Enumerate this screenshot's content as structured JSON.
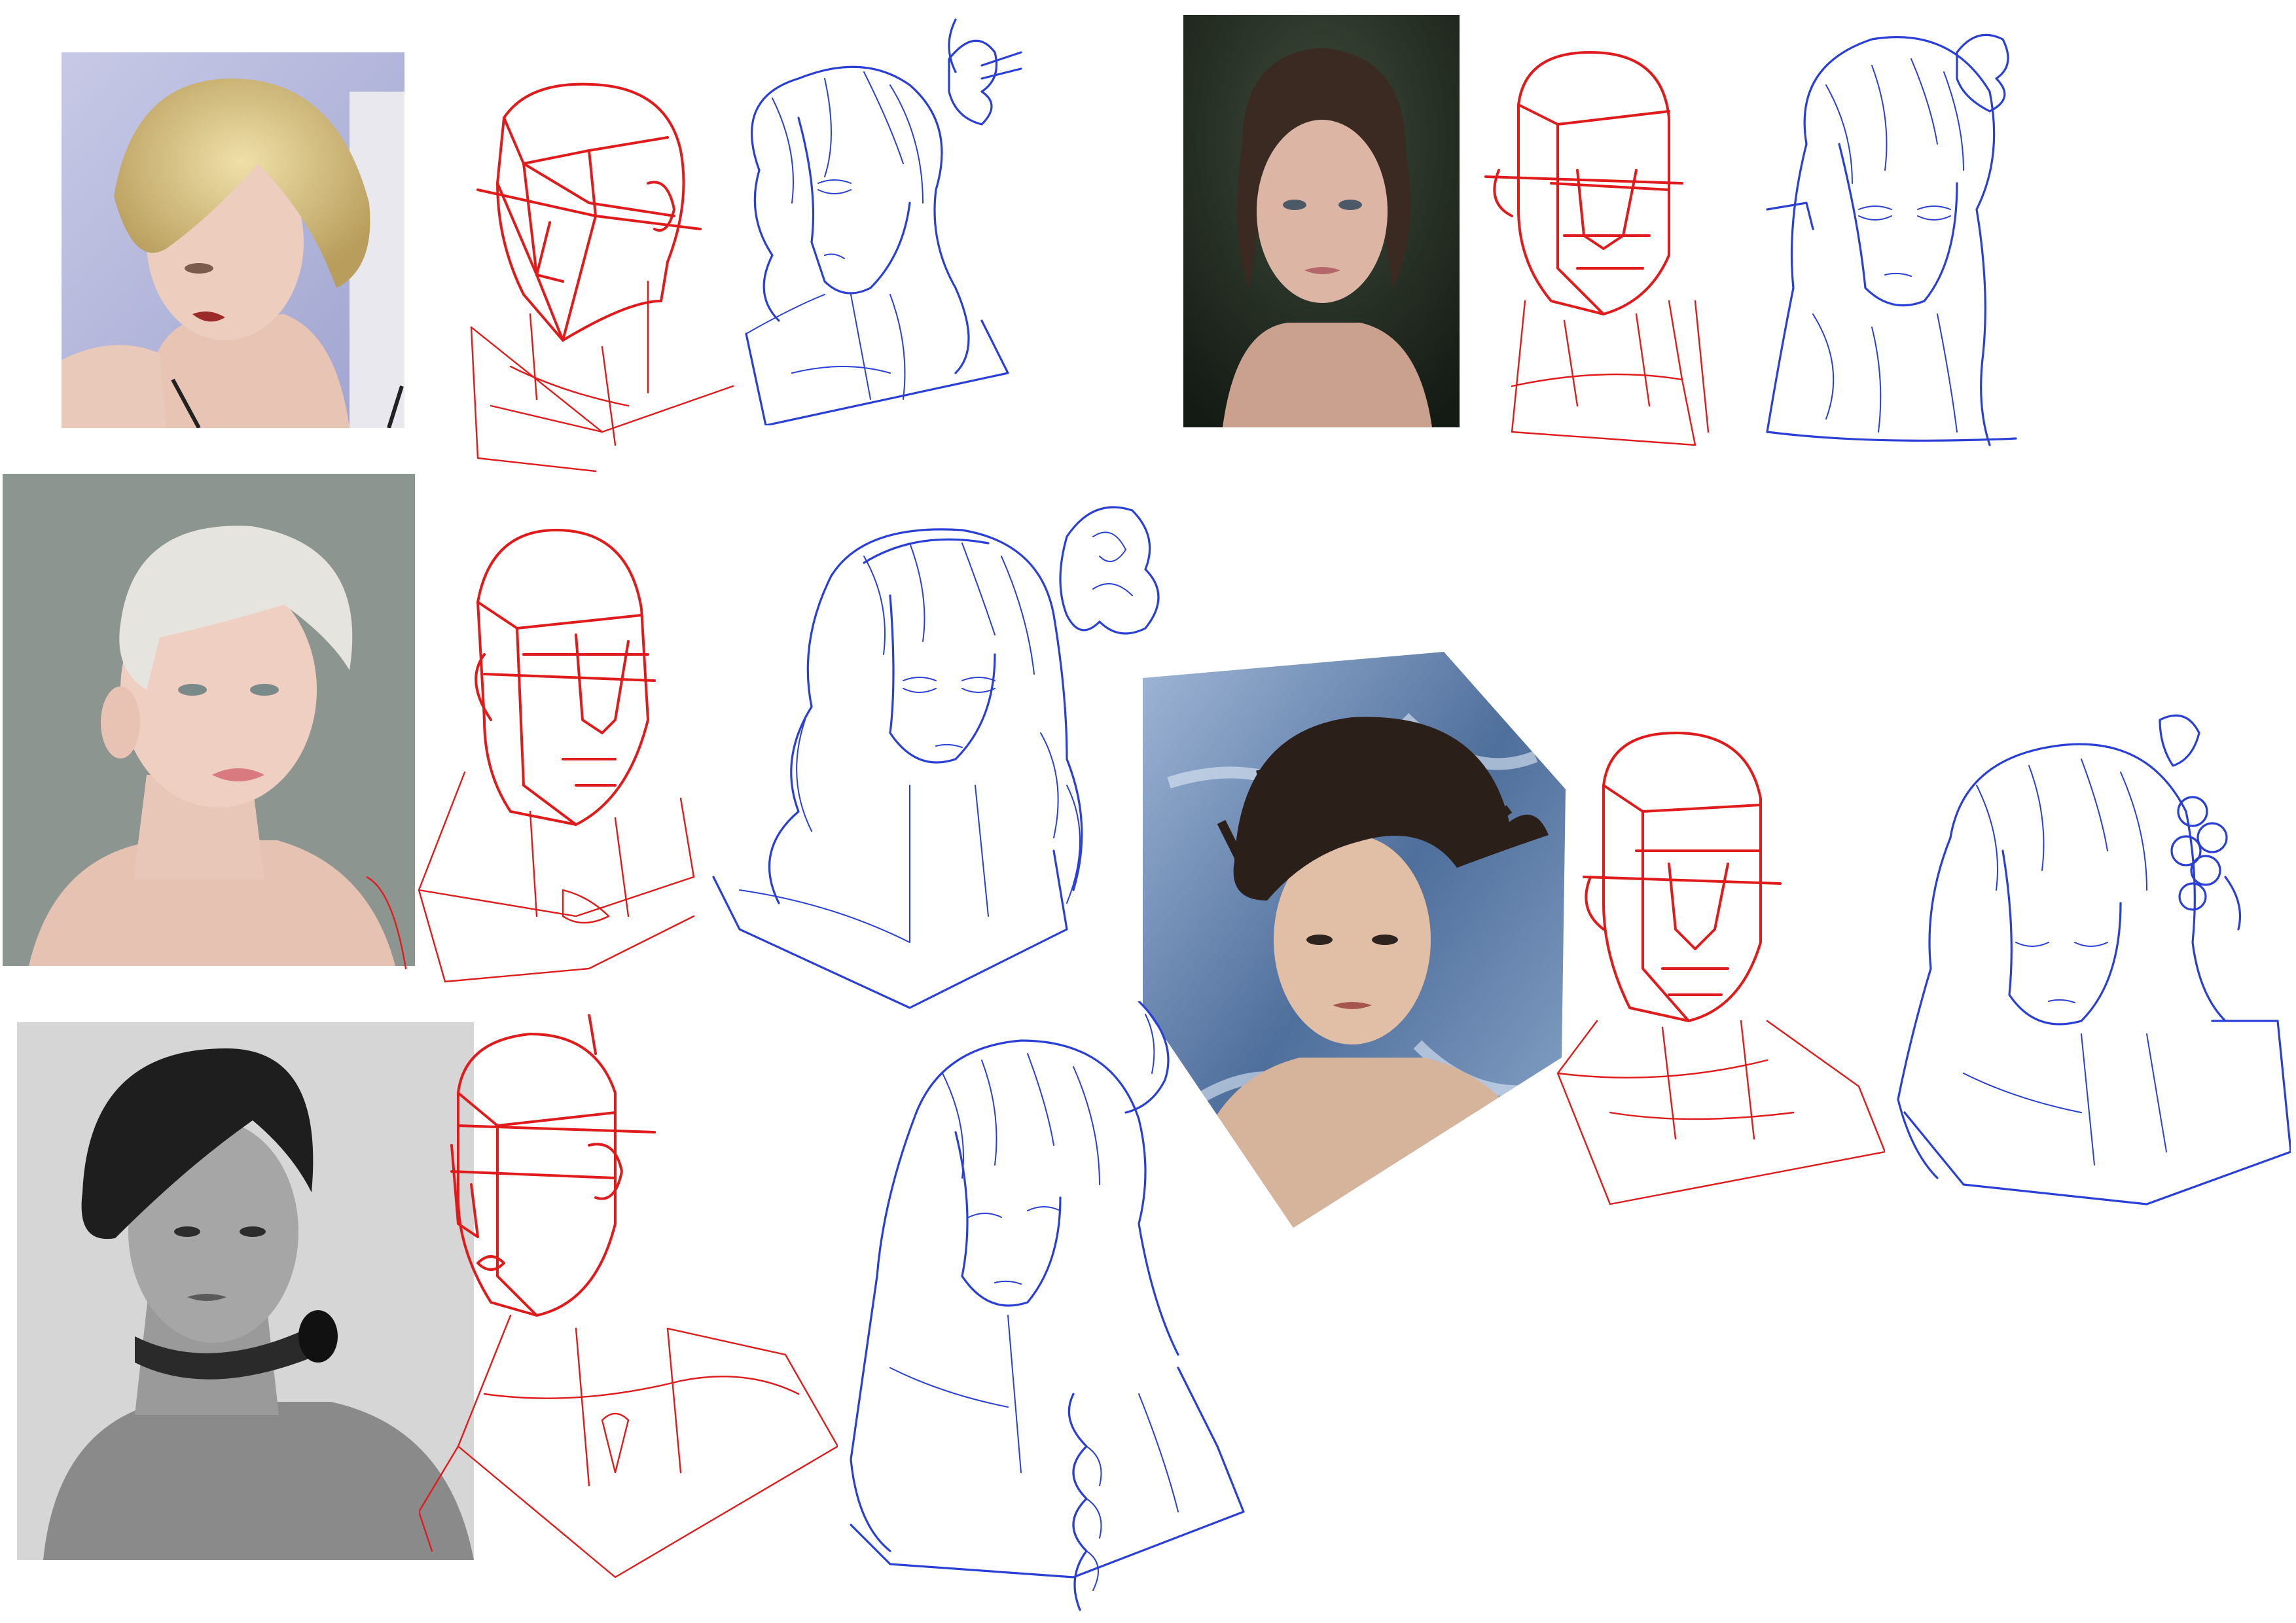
{
  "canvas": {
    "background": "#ffffff"
  },
  "colors": {
    "construction_sketch": "#e01b1b",
    "line_art_sketch": "#2a3fd6"
  },
  "studies": [
    {
      "id": "study-1",
      "photo": "blonde-bob-portrait",
      "construction": "red-head-construction",
      "lineart": "blue-lineart-with-butterfly-hairpin"
    },
    {
      "id": "study-2",
      "photo": "brunette-portrait-dark-background",
      "construction": "red-head-construction",
      "lineart": "blue-lineart-with-flower-ornament"
    },
    {
      "id": "study-3",
      "photo": "platinum-hair-portrait-grey-background",
      "construction": "red-head-construction",
      "lineart": "blue-lineart-curly-hair-with-bun"
    },
    {
      "id": "study-4",
      "photo": "windswept-hair-portrait-blue-background",
      "construction": "red-head-construction",
      "lineart": "blue-lineart-with-grape-ornament"
    },
    {
      "id": "study-5",
      "photo": "black-hair-portrait-with-choker",
      "construction": "red-head-construction",
      "lineart": "blue-lineart-long-braid-with-feather"
    }
  ]
}
